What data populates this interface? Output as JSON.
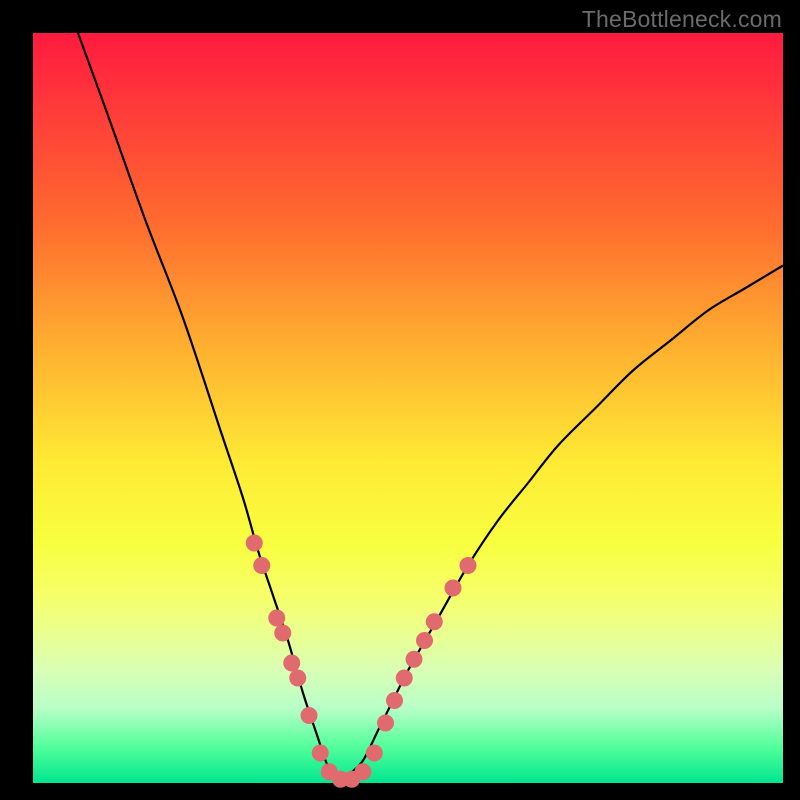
{
  "watermark": "TheBottleneck.com",
  "colors": {
    "frame": "#000000",
    "curve": "#000000",
    "marker_fill": "#e06a6d",
    "marker_stroke": "#d75a5d"
  },
  "chart_data": {
    "type": "line",
    "title": "",
    "xlabel": "",
    "ylabel": "",
    "xlim": [
      0,
      100
    ],
    "ylim": [
      0,
      100
    ],
    "series": [
      {
        "name": "bottleneck-curve",
        "x": [
          6,
          10,
          15,
          20,
          25,
          28,
          30,
          32,
          34,
          36,
          38,
          39,
          40,
          41,
          42,
          44,
          46,
          48,
          50,
          54,
          58,
          62,
          66,
          70,
          75,
          80,
          85,
          90,
          95,
          100
        ],
        "y": [
          100,
          89,
          75,
          62,
          47,
          38,
          31,
          25,
          19,
          12,
          6,
          3,
          1,
          0,
          1,
          3,
          7,
          11,
          15,
          22,
          29,
          35,
          40,
          45,
          50,
          55,
          59,
          63,
          66,
          69
        ]
      }
    ],
    "markers": [
      {
        "x": 29.5,
        "y": 32
      },
      {
        "x": 30.5,
        "y": 29
      },
      {
        "x": 32.5,
        "y": 22
      },
      {
        "x": 33.3,
        "y": 20
      },
      {
        "x": 34.5,
        "y": 16
      },
      {
        "x": 35.3,
        "y": 14
      },
      {
        "x": 36.8,
        "y": 9
      },
      {
        "x": 38.3,
        "y": 4
      },
      {
        "x": 39.5,
        "y": 1.5
      },
      {
        "x": 41.0,
        "y": 0.5
      },
      {
        "x": 42.5,
        "y": 0.5
      },
      {
        "x": 44.0,
        "y": 1.5
      },
      {
        "x": 45.5,
        "y": 4
      },
      {
        "x": 47.0,
        "y": 8
      },
      {
        "x": 48.2,
        "y": 11
      },
      {
        "x": 49.5,
        "y": 14
      },
      {
        "x": 50.8,
        "y": 16.5
      },
      {
        "x": 52.2,
        "y": 19
      },
      {
        "x": 53.5,
        "y": 21.5
      },
      {
        "x": 56.0,
        "y": 26
      },
      {
        "x": 58.0,
        "y": 29
      }
    ],
    "marker_radius": 8.5
  }
}
